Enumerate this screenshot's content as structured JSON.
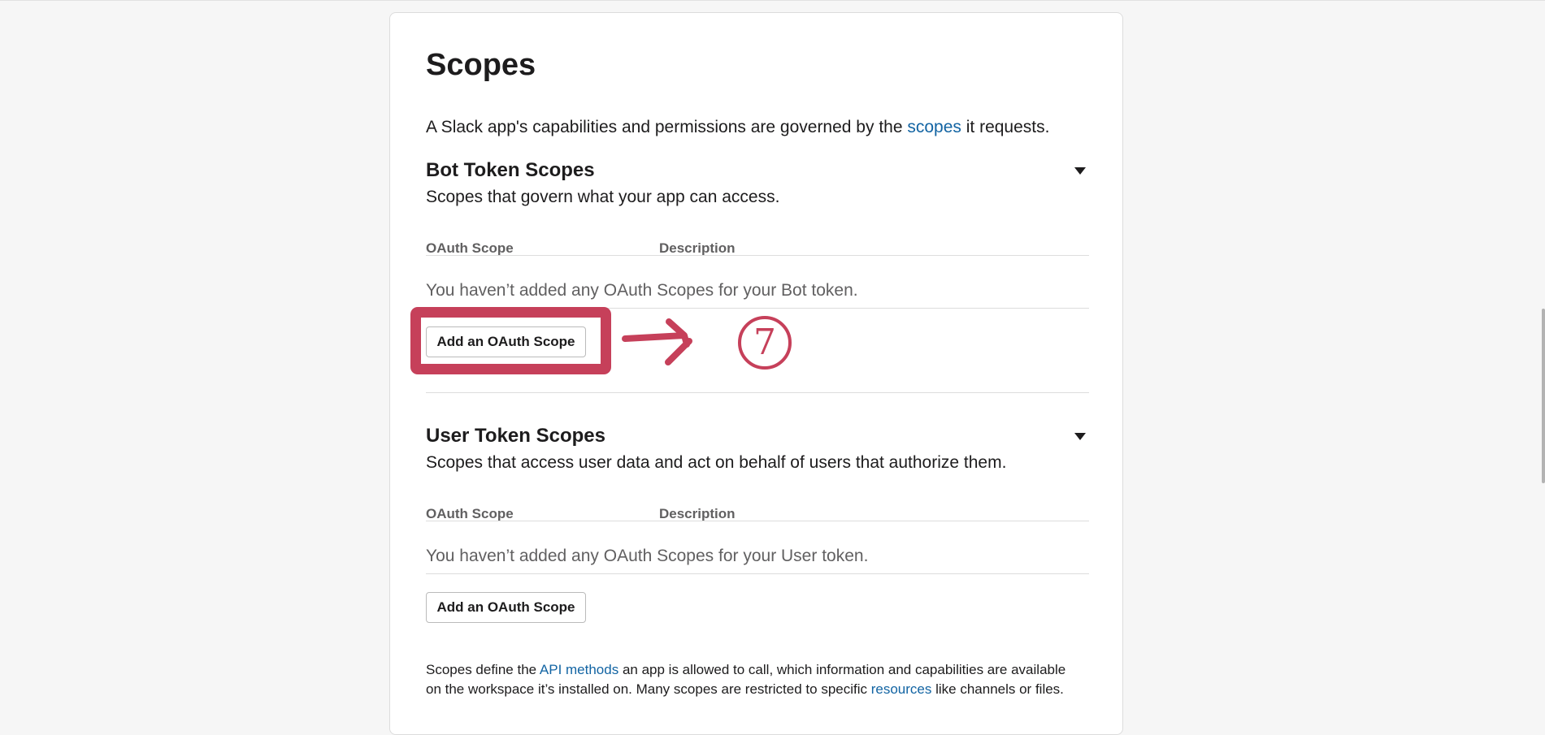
{
  "page": {
    "title": "Scopes",
    "intro_before": "A Slack app's capabilities and permissions are governed by the ",
    "intro_link": "scopes",
    "intro_after": " it requests."
  },
  "bot_section": {
    "title": "Bot Token Scopes",
    "description": "Scopes that govern what your app can access.",
    "col_scope": "OAuth Scope",
    "col_description": "Description",
    "empty_message": "You haven’t added any OAuth Scopes for your Bot token.",
    "add_button": "Add an OAuth Scope"
  },
  "user_section": {
    "title": "User Token Scopes",
    "description": "Scopes that access user data and act on behalf of users that authorize them.",
    "col_scope": "OAuth Scope",
    "col_description": "Description",
    "empty_message": "You haven’t added any OAuth Scopes for your User token.",
    "add_button": "Add an OAuth Scope"
  },
  "footer": {
    "line1_before": "Scopes define the ",
    "line1_link": "API methods",
    "line1_after": " an app is allowed to call, which information and capabilities are available",
    "line2_before": "on the workspace it’s installed on. Many scopes are restricted to specific ",
    "line2_link": "resources",
    "line2_after": " like channels or files."
  },
  "annotation": {
    "step_label": "⑦",
    "color": "#c6405a"
  },
  "colors": {
    "link": "#1264a3",
    "text": "#1d1c1d",
    "muted": "#616061"
  }
}
